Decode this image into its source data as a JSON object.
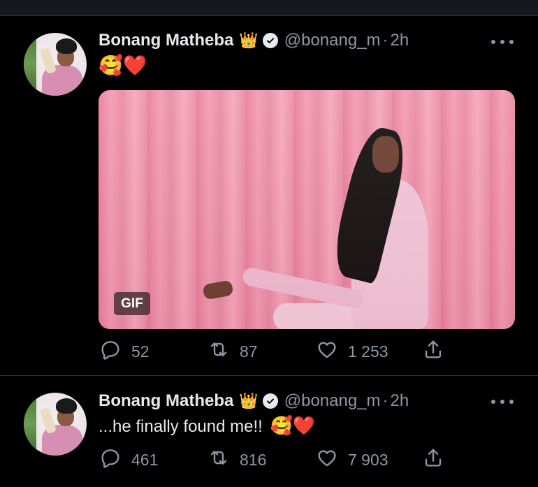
{
  "tweets": [
    {
      "author_name": "Bonang Matheba",
      "name_emoji": "👑",
      "handle": "@bonang_m",
      "separator": "·",
      "time": "2h",
      "text": "🥰❤️",
      "media": {
        "badge": "GIF"
      },
      "actions": {
        "replies": "52",
        "retweets": "87",
        "likes": "1 253"
      }
    },
    {
      "author_name": "Bonang Matheba",
      "name_emoji": "👑",
      "handle": "@bonang_m",
      "separator": "·",
      "time": "2h",
      "text": "...he finally found me!!",
      "text_emoji": "🥰❤️",
      "actions": {
        "replies": "461",
        "retweets": "816",
        "likes": "7 903"
      }
    }
  ],
  "icons": {
    "verified": "verified-badge-icon",
    "more": "more-horizontal-icon",
    "reply": "reply-icon",
    "retweet": "retweet-icon",
    "like": "heart-icon",
    "share": "share-icon"
  },
  "colors": {
    "background": "#000000",
    "text": "#e7e9ea",
    "muted": "#8b98a5",
    "divider": "#2f3336"
  }
}
